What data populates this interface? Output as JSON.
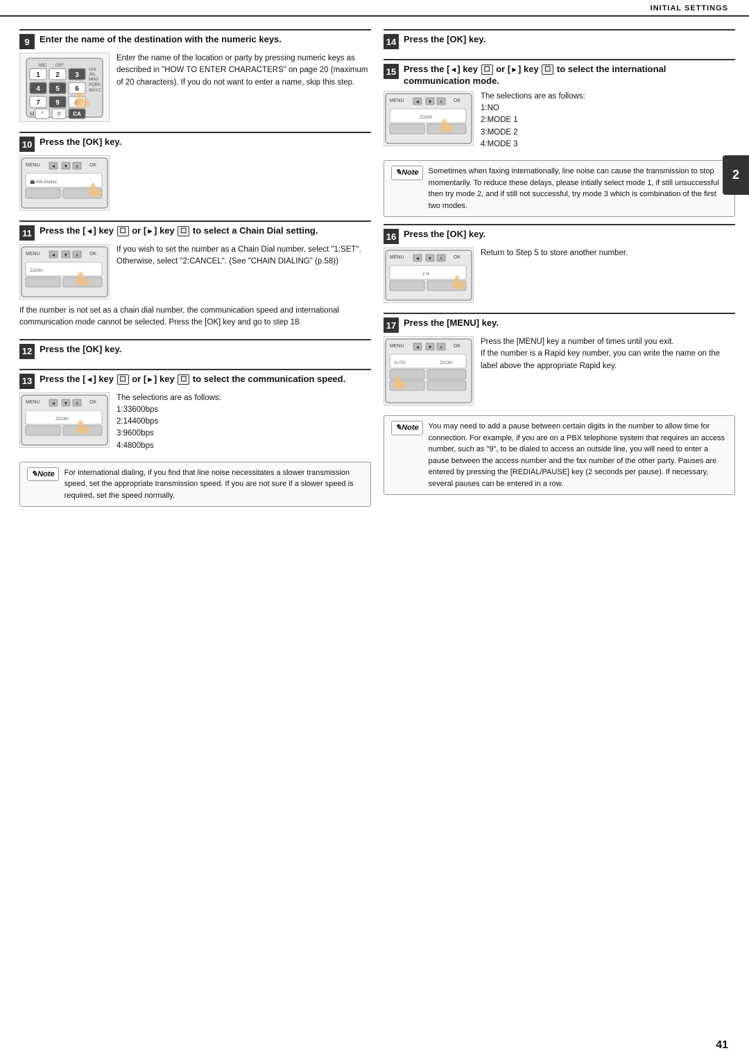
{
  "header": {
    "title": "INITIAL SETTINGS"
  },
  "page_number": "41",
  "chapter_number": "2",
  "steps": {
    "step9": {
      "number": "9",
      "title": "Enter the name of the destination with the numeric keys.",
      "text": "Enter the name of the location or party by pressing numeric keys as described in \"HOW TO ENTER CHARACTERS\" on page 20 (maximum of 20 characters). If you do not want to enter a name, skip this step."
    },
    "step10": {
      "number": "10",
      "title": "Press the [OK] key.",
      "text": ""
    },
    "step11": {
      "number": "11",
      "title": "Press the [◄] key (□) or [►] key (□) to select a Chain Dial setting.",
      "text": "If you wish to set the number as a Chain Dial number, select \"1:SET\". Otherwise, select \"2:CANCEL\". (See \"CHAIN DIALING\" (p.58))"
    },
    "step11_body": "If the number is not set as a chain dial number, the communication speed and international communication mode cannot be selected. Press the [OK] key and go to step 18.",
    "step12": {
      "number": "12",
      "title": "Press the [OK] key.",
      "text": ""
    },
    "step13": {
      "number": "13",
      "title": "Press the [◄] key (□) or [►] key (□) to select the communication speed.",
      "text": "The selections are as follows:\n1:33600bps\n2:14400bps\n3:9600bps\n4:4800bps"
    },
    "step13_note": "For international dialing, if you find that line noise necessitates a slower transmission speed, set the appropriate transmission speed. If you are not sure if a slower speed is required, set the speed normally.",
    "step14": {
      "number": "14",
      "title": "Press the [OK] key.",
      "text": ""
    },
    "step15": {
      "number": "15",
      "title": "Press the [◄] key (□) or [►] key (□) to select the international communication mode.",
      "text": "The selections are as follows:\n1:NO\n2:MODE 1\n3:MODE 2\n4:MODE 3"
    },
    "step15_note": "Sometimes when faxing internationally, line noise can cause the transmission to stop momentarily. To reduce these delays, please intially select mode 1, if still unsuccessful then try mode 2, and if still not successful, try mode 3 which is combination of the first two modes.",
    "step16": {
      "number": "16",
      "title": "Press the [OK] key.",
      "text": "Return to Step 5 to store another number."
    },
    "step17": {
      "number": "17",
      "title": "Press the [MENU] key.",
      "text": "Press the [MENU] key a number of times until you exit.\nIf the number is a Rapid key number, you can write the name on the label above the appropriate Rapid key."
    },
    "step17_note": "You may need to add a pause between certain digits in the number to allow time for connection. For example, if you are on a PBX telephone system that requires an access number, such as \"9\", to be dialed to access an outside line, you will need to enter a pause between the access number and the fax number of the other party. Pauses are entered by pressing the [REDIAL/PAUSE] key (2 seconds per pause). If necessary, several pauses can be entered in a row.",
    "note_label": "Note"
  }
}
